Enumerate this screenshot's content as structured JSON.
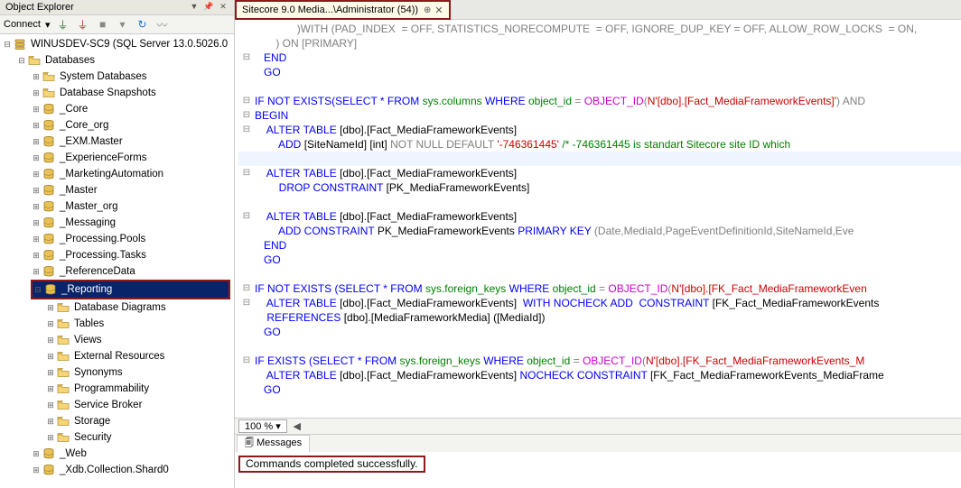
{
  "panel": {
    "title": "Object Explorer"
  },
  "toolbar": {
    "connect": "Connect"
  },
  "serverRoot": "WINUSDEV-SC9 (SQL Server 13.0.5026.0",
  "dbNode": "Databases",
  "sysDb": "System Databases",
  "snapDb": "Database Snapshots",
  "databases": [
    "_Core",
    "_Core_org",
    "_EXM.Master",
    "_ExperienceForms",
    "_MarketingAutomation",
    "_Master",
    "_Master_org",
    "_Messaging",
    "_Processing.Pools",
    "_Processing.Tasks",
    "_ReferenceData",
    "_Reporting",
    "_Web",
    "_Xdb.Collection.Shard0"
  ],
  "selectedDb": "_Reporting",
  "expandedDb": "_Reporting",
  "dbChildren": [
    "Database Diagrams",
    "Tables",
    "Views",
    "External Resources",
    "Synonyms",
    "Programmability",
    "Service Broker",
    "Storage",
    "Security"
  ],
  "tab": {
    "label": "Sitecore 9.0 Media...\\Administrator (54))"
  },
  "zoom": "100 %",
  "messagesTab": "Messages",
  "successMsg": "Commands completed successfully.",
  "sql": {
    "l1": ")WITH (PAD_INDEX  = OFF, STATISTICS_NORECOMPUTE  = OFF, IGNORE_DUP_KEY = OFF, ALLOW_ROW_LOCKS  = ON,",
    "l2": ") ON [PRIMARY]",
    "l3": "END",
    "l4": "GO",
    "l5_a": "IF NOT EXISTS(",
    "l5_b": "SELECT * FROM ",
    "l5_c": "sys.columns",
    "l5_d": " WHERE ",
    "l5_e": "object_id",
    "l5_f": " = ",
    "l5_g": "OBJECT_ID",
    "l5_h": "(",
    "l5_i": "N'[dbo].[Fact_MediaFrameworkEvents]'",
    "l5_j": ") AND",
    "l6": "BEGIN",
    "l7_a": "ALTER TABLE ",
    "l7_b": "[dbo].[Fact_MediaFrameworkEvents]",
    "l8_a": "ADD ",
    "l8_b": "[SiteNameId] [int] ",
    "l8_c": "NOT NULL DEFAULT ",
    "l8_d": "'-746361445'",
    "l8_e": " /* -746361445 is standart Sitecore site ID which",
    "l9_a": "ALTER TABLE ",
    "l9_b": "[dbo].[Fact_MediaFrameworkEvents]",
    "l10_a": "DROP CONSTRAINT ",
    "l10_b": "[PK_MediaFrameworkEvents]",
    "l11_a": "ALTER TABLE ",
    "l11_b": "[dbo].[Fact_MediaFrameworkEvents]",
    "l12_a": "ADD CONSTRAINT ",
    "l12_b": "PK_MediaFrameworkEvents ",
    "l12_c": "PRIMARY KEY ",
    "l12_d": "(Date,MediaId,PageEventDefinitionId,SiteNameId,Eve",
    "l13": "END",
    "l14": "GO",
    "l15_a": "IF NOT EXISTS (",
    "l15_b": "SELECT * FROM ",
    "l15_c": "sys.foreign_keys",
    "l15_d": " WHERE ",
    "l15_e": "object_id",
    "l15_f": " = ",
    "l15_g": "OBJECT_ID",
    "l15_h": "(",
    "l15_i": "N'[dbo].[FK_Fact_MediaFrameworkEven",
    "l16_a": "ALTER TABLE ",
    "l16_b": "[dbo].[Fact_MediaFrameworkEvents]  ",
    "l16_c": "WITH NOCHECK ADD  CONSTRAINT ",
    "l16_d": "[FK_Fact_MediaFrameworkEvents",
    "l17_a": "REFERENCES ",
    "l17_b": "[dbo].[MediaFrameworkMedia] ([MediaId])",
    "l18": "GO",
    "l19_a": "IF EXISTS (",
    "l19_b": "SELECT * FROM ",
    "l19_c": "sys.foreign_keys",
    "l19_d": " WHERE ",
    "l19_e": "object_id",
    "l19_f": " = ",
    "l19_g": "OBJECT_ID",
    "l19_h": "(",
    "l19_i": "N'[dbo].[FK_Fact_MediaFrameworkEvents_M",
    "l20_a": "ALTER TABLE ",
    "l20_b": "[dbo].[Fact_MediaFrameworkEvents] ",
    "l20_c": "NOCHECK CONSTRAINT ",
    "l20_d": "[FK_Fact_MediaFrameworkEvents_MediaFrame",
    "l21": "GO"
  }
}
